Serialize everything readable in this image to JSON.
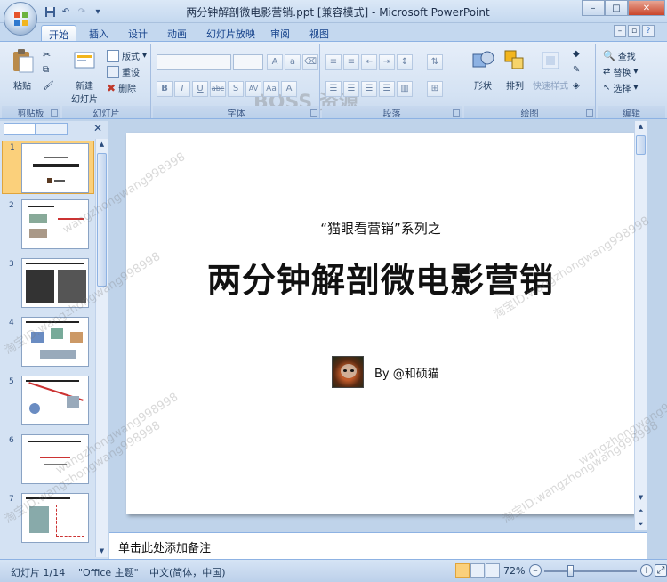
{
  "window": {
    "title": "两分钟解剖微电影营销.ppt [兼容模式] - Microsoft PowerPoint",
    "controls": [
      "minimize",
      "maximize",
      "close"
    ]
  },
  "ribbon_tabs": [
    "开始",
    "插入",
    "设计",
    "动画",
    "幻灯片放映",
    "审阅",
    "视图"
  ],
  "active_tab": "开始",
  "ribbon": {
    "clipboard": {
      "label": "剪贴板",
      "paste": "粘贴"
    },
    "slides": {
      "label": "幻灯片",
      "new_slide_line1": "新建",
      "new_slide_line2": "幻灯片",
      "layout": "版式",
      "reset": "重设",
      "delete": "删除"
    },
    "font": {
      "label": "字体",
      "bold": "B",
      "italic": "I",
      "underline": "U",
      "strike": "abc",
      "shadow": "S",
      "spacing": "AV",
      "case": "Aa",
      "color": "A"
    },
    "paragraph": {
      "label": "段落"
    },
    "drawing": {
      "label": "绘图",
      "shapes": "形状",
      "arrange": "排列",
      "quick_styles": "快速样式"
    },
    "editing": {
      "label": "编辑",
      "find": "查找",
      "replace": "替换",
      "select": "选择"
    }
  },
  "slide": {
    "subtitle": "“猫眼看营销”系列之",
    "title": "两分钟解剖微电影营销",
    "author": "By @和硕猫"
  },
  "thumbnails": [
    "1",
    "2",
    "3",
    "4",
    "5",
    "6",
    "7"
  ],
  "notes_placeholder": "单击此处添加备注",
  "status": {
    "slide_info": "幻灯片 1/14",
    "theme": "\"Office 主题\"",
    "language": "中文(简体，中国)",
    "zoom": "72%"
  },
  "watermarks": {
    "boss": "BOSS 资源",
    "shop": "淘宝ID:wangzhongwang998998",
    "short": "wangzhongwang998998"
  }
}
